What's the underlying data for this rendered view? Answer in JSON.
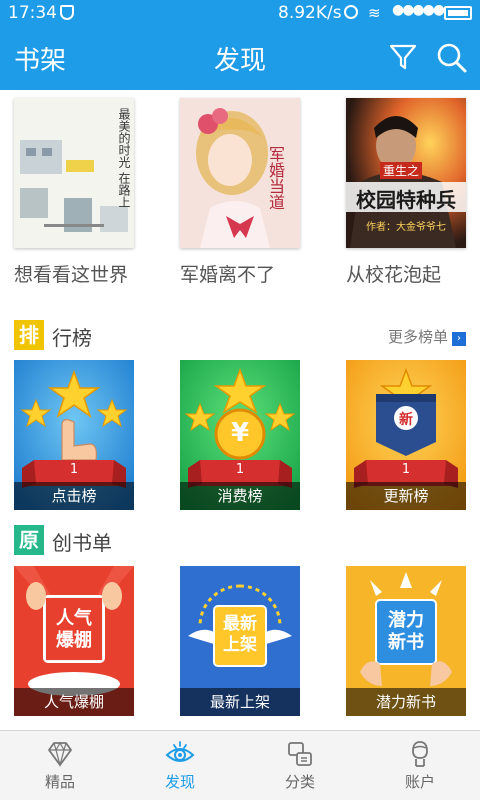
{
  "status_bar": {
    "time": "17:34",
    "speed": "8.92K/s",
    "signal": "●●●●●"
  },
  "app_bar": {
    "left_title": "书架",
    "center_title": "发现",
    "filter_icon": "filter-icon",
    "search_icon": "search-icon"
  },
  "featured_books": [
    {
      "title": "想看看这世界",
      "cover_text": "最美的时光 在路上"
    },
    {
      "title": "军婚离不了",
      "cover_text": "军婚当道"
    },
    {
      "title": "从校花泡起",
      "cover_text": "重生之 校园特种兵",
      "cover_author": "作者：大金爷爷七"
    }
  ],
  "ranking_section": {
    "tag": "排",
    "label": "行榜",
    "more": "更多榜单",
    "tag_color": "#f0c400",
    "cards": [
      {
        "caption": "点击榜",
        "rank": "1"
      },
      {
        "caption": "消费榜",
        "rank": "1",
        "emblem": "¥"
      },
      {
        "caption": "更新榜",
        "rank": "1",
        "emblem": "新"
      }
    ]
  },
  "original_section": {
    "tag": "原",
    "label": "创书单",
    "tag_color": "#26b88a",
    "cards": [
      {
        "caption": "人气爆棚",
        "badge": "人气\n爆棚"
      },
      {
        "caption": "最新上架",
        "badge": "最新\n上架"
      },
      {
        "caption": "潜力新书",
        "badge": "潜力\n新书"
      }
    ]
  },
  "bottom_nav": [
    {
      "label": "精品",
      "icon": "diamond-icon"
    },
    {
      "label": "发现",
      "icon": "eye-icon",
      "active": true
    },
    {
      "label": "分类",
      "icon": "category-icon"
    },
    {
      "label": "账户",
      "icon": "user-icon"
    }
  ],
  "colors": {
    "primary": "#1e9ce8",
    "ranking_tag": "#f0c400",
    "original_tag": "#26b88a"
  }
}
